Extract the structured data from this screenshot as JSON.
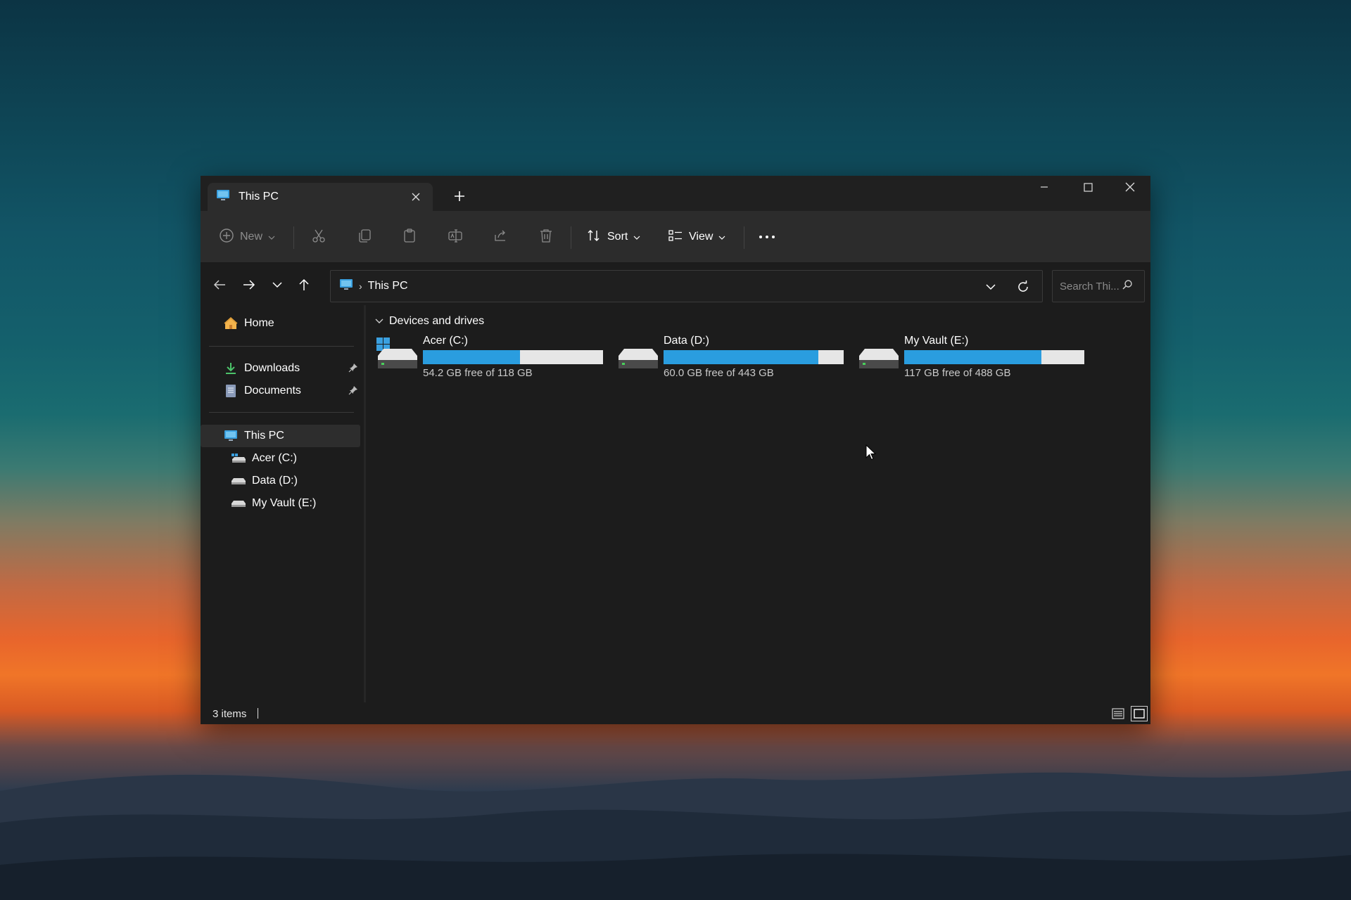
{
  "window": {
    "tab_title": "This PC",
    "tab_icon": "this-pc-icon"
  },
  "toolbar": {
    "new_label": "New",
    "sort_label": "Sort",
    "view_label": "View",
    "icons": [
      "add-circle-icon",
      "cut-icon",
      "copy-icon",
      "paste-icon",
      "rename-icon",
      "share-icon",
      "delete-icon",
      "sort-icon",
      "view-icon",
      "more-icon"
    ]
  },
  "navigation": {
    "breadcrumb": [
      "This PC"
    ],
    "search_placeholder": "Search Thi..."
  },
  "sidebar": {
    "home": "Home",
    "pinned": [
      {
        "label": "Downloads",
        "icon": "downloads-icon"
      },
      {
        "label": "Documents",
        "icon": "documents-icon"
      }
    ],
    "this_pc": "This PC",
    "drives": [
      {
        "label": "Acer (C:)",
        "icon": "windows-drive-icon"
      },
      {
        "label": "Data (D:)",
        "icon": "drive-icon"
      },
      {
        "label": "My Vault (E:)",
        "icon": "drive-icon"
      }
    ]
  },
  "content": {
    "group_title": "Devices and drives",
    "drives": [
      {
        "name": "Acer (C:)",
        "free_text": "54.2 GB free of 118 GB",
        "used_fraction": 0.54
      },
      {
        "name": "Data (D:)",
        "free_text": "60.0 GB free of 443 GB",
        "used_fraction": 0.86
      },
      {
        "name": "My Vault (E:)",
        "free_text": "117 GB free of 488 GB",
        "used_fraction": 0.76
      }
    ]
  },
  "status": {
    "items_text": "3 items"
  },
  "colors": {
    "accent": "#2a9ddf",
    "window_bg": "#1c1c1c",
    "toolbar_bg": "#2c2c2c"
  }
}
